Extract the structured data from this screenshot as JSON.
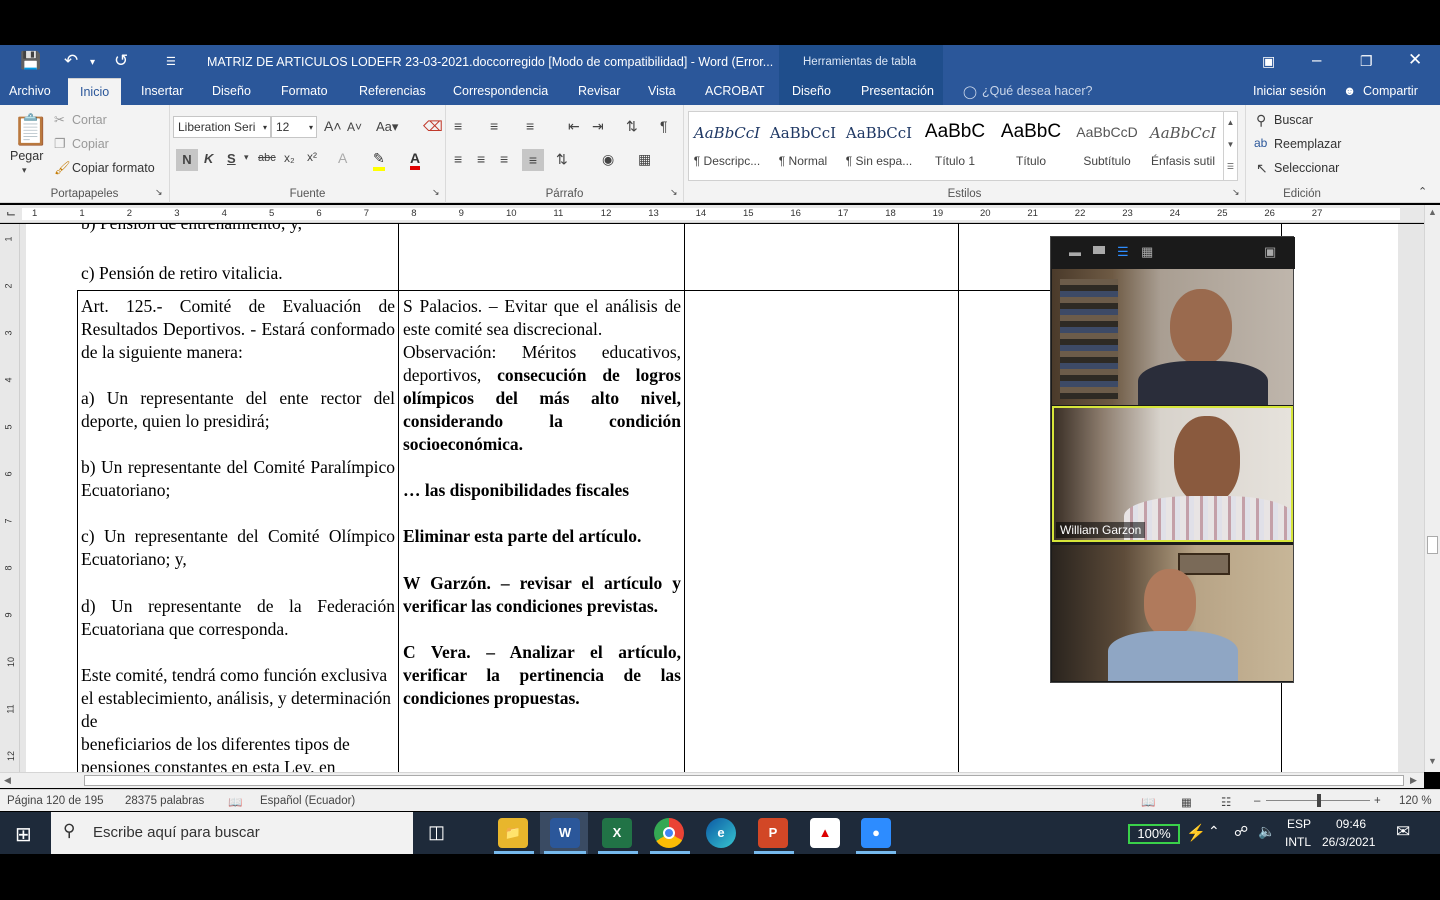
{
  "window": {
    "title": "MATRIZ DE ARTICULOS LODEFR 23-03-2021.doccorregido [Modo de compatibilidad] - Word (Error...",
    "context_tab_title": "Herramientas de tabla"
  },
  "tabs": {
    "file": "Archivo",
    "items": [
      "Inicio",
      "Insertar",
      "Diseño",
      "Formato",
      "Referencias",
      "Correspondencia",
      "Revisar",
      "Vista",
      "ACROBAT",
      "Diseño",
      "Presentación"
    ],
    "tell_me": "¿Qué desea hacer?",
    "signin": "Iniciar sesión",
    "share": "Compartir"
  },
  "ribbon": {
    "clipboard": {
      "paste": "Pegar",
      "cut": "Cortar",
      "copy": "Copiar",
      "format_painter": "Copiar formato",
      "label": "Portapapeles"
    },
    "font": {
      "name": "Liberation Seri",
      "size": "12",
      "label": "Fuente",
      "bold": "N",
      "italic": "K",
      "underline": "S"
    },
    "paragraph": {
      "label": "Párrafo"
    },
    "styles": {
      "label": "Estilos",
      "items": [
        {
          "sample": "AaBbCcI",
          "name": "¶ Descripc..."
        },
        {
          "sample": "AaBbCcI",
          "name": "¶ Normal"
        },
        {
          "sample": "AaBbCcI",
          "name": "¶ Sin espa..."
        },
        {
          "sample": "AaBbC",
          "name": "Título 1"
        },
        {
          "sample": "AaBbC",
          "name": "Título"
        },
        {
          "sample": "AaBbCcD",
          "name": "Subtítulo"
        },
        {
          "sample": "AaBbCcI",
          "name": "Énfasis sutil"
        }
      ]
    },
    "editing": {
      "find": "Buscar",
      "replace": "Reemplazar",
      "select": "Seleccionar",
      "label": "Edición"
    }
  },
  "ruler": {
    "numbers": [
      "1",
      "1",
      "2",
      "3",
      "4",
      "5",
      "6",
      "7",
      "8",
      "9",
      "10",
      "11",
      "12",
      "13",
      "14",
      "15",
      "16",
      "17",
      "18",
      "19",
      "20",
      "21",
      "22",
      "23",
      "24",
      "25",
      "26",
      "27"
    ]
  },
  "document": {
    "top_cut_text": "b) Pensión de entrenamiento; y,",
    "top_left_text": "c) Pensión de retiro vitalicia.",
    "col1": [
      "Art. 125.- Comité de Evaluación de Resultados Deportivos. - Estará conformado de la siguiente manera:",
      "a) Un representante del ente rector del deporte, quien lo presidirá;",
      "b) Un representante del Comité Paralímpico Ecuatoriano;",
      "c) Un representante del Comité Olímpico Ecuatoriano; y,",
      "d) Un representante de la Federación Ecuatoriana que corresponda.",
      "Este comité, tendrá como función exclusiva el establecimiento, análisis, y determinación de",
      "beneficiarios de los diferentes tipos de",
      "pensiones constantes en esta Ley, en"
    ],
    "col2": {
      "p1": "S Palacios. – Evitar que el análisis de este comité sea discrecional.",
      "p2_plain": "Observación: Méritos educativos, deportivos,",
      "p2_bold": "consecución de logros olímpicos del más alto nivel, considerando la condición socioeconómica.",
      "p3": "… las disponibilidades fiscales",
      "p4": "Eliminar esta parte del artículo.",
      "p5": "W Garzón. – revisar el artículo y verificar las condiciones previstas.",
      "p6": "C Vera. – Analizar el artículo, verificar la pertinencia de las condiciones propuestas."
    }
  },
  "status": {
    "page": "Página 120 de 195",
    "words": "28375 palabras",
    "language": "Español (Ecuador)",
    "zoom": "120 %"
  },
  "zoom_panel": {
    "participants": [
      {
        "name": ""
      },
      {
        "name": "William Garzon"
      },
      {
        "name": ""
      }
    ]
  },
  "taskbar": {
    "search_placeholder": "Escribe aquí para buscar",
    "battery": "100%",
    "lang1": "ESP",
    "lang2": "INTL",
    "time": "09:46",
    "date": "26/3/2021"
  }
}
